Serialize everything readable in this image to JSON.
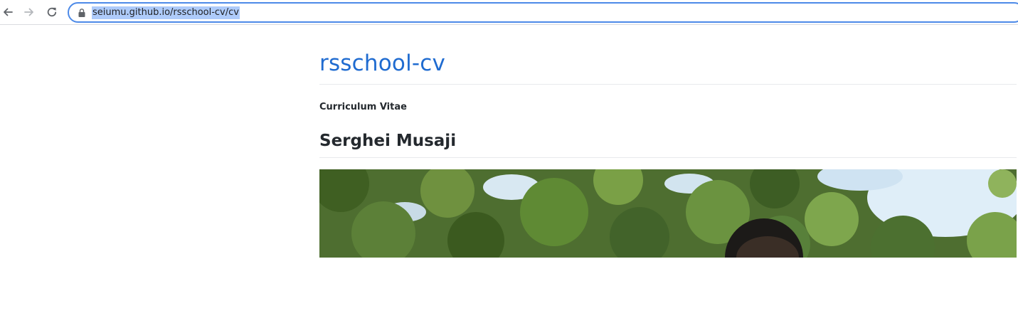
{
  "browser": {
    "url": "seiumu.github.io/rsschool-cv/cv",
    "back_icon": "arrow-left-icon",
    "forward_icon": "arrow-right-icon",
    "reload_icon": "reload-icon",
    "lock_icon": "lock-icon"
  },
  "page": {
    "site_title": "rsschool-cv",
    "subtitle": "Curriculum Vitae",
    "name": "Serghei Musaji",
    "photo": "profile-photo"
  },
  "colors": {
    "link": "#1f6bd0",
    "text": "#24292e",
    "url_highlight": "#aecbfa",
    "omnibox_border": "#4d8ae8"
  }
}
